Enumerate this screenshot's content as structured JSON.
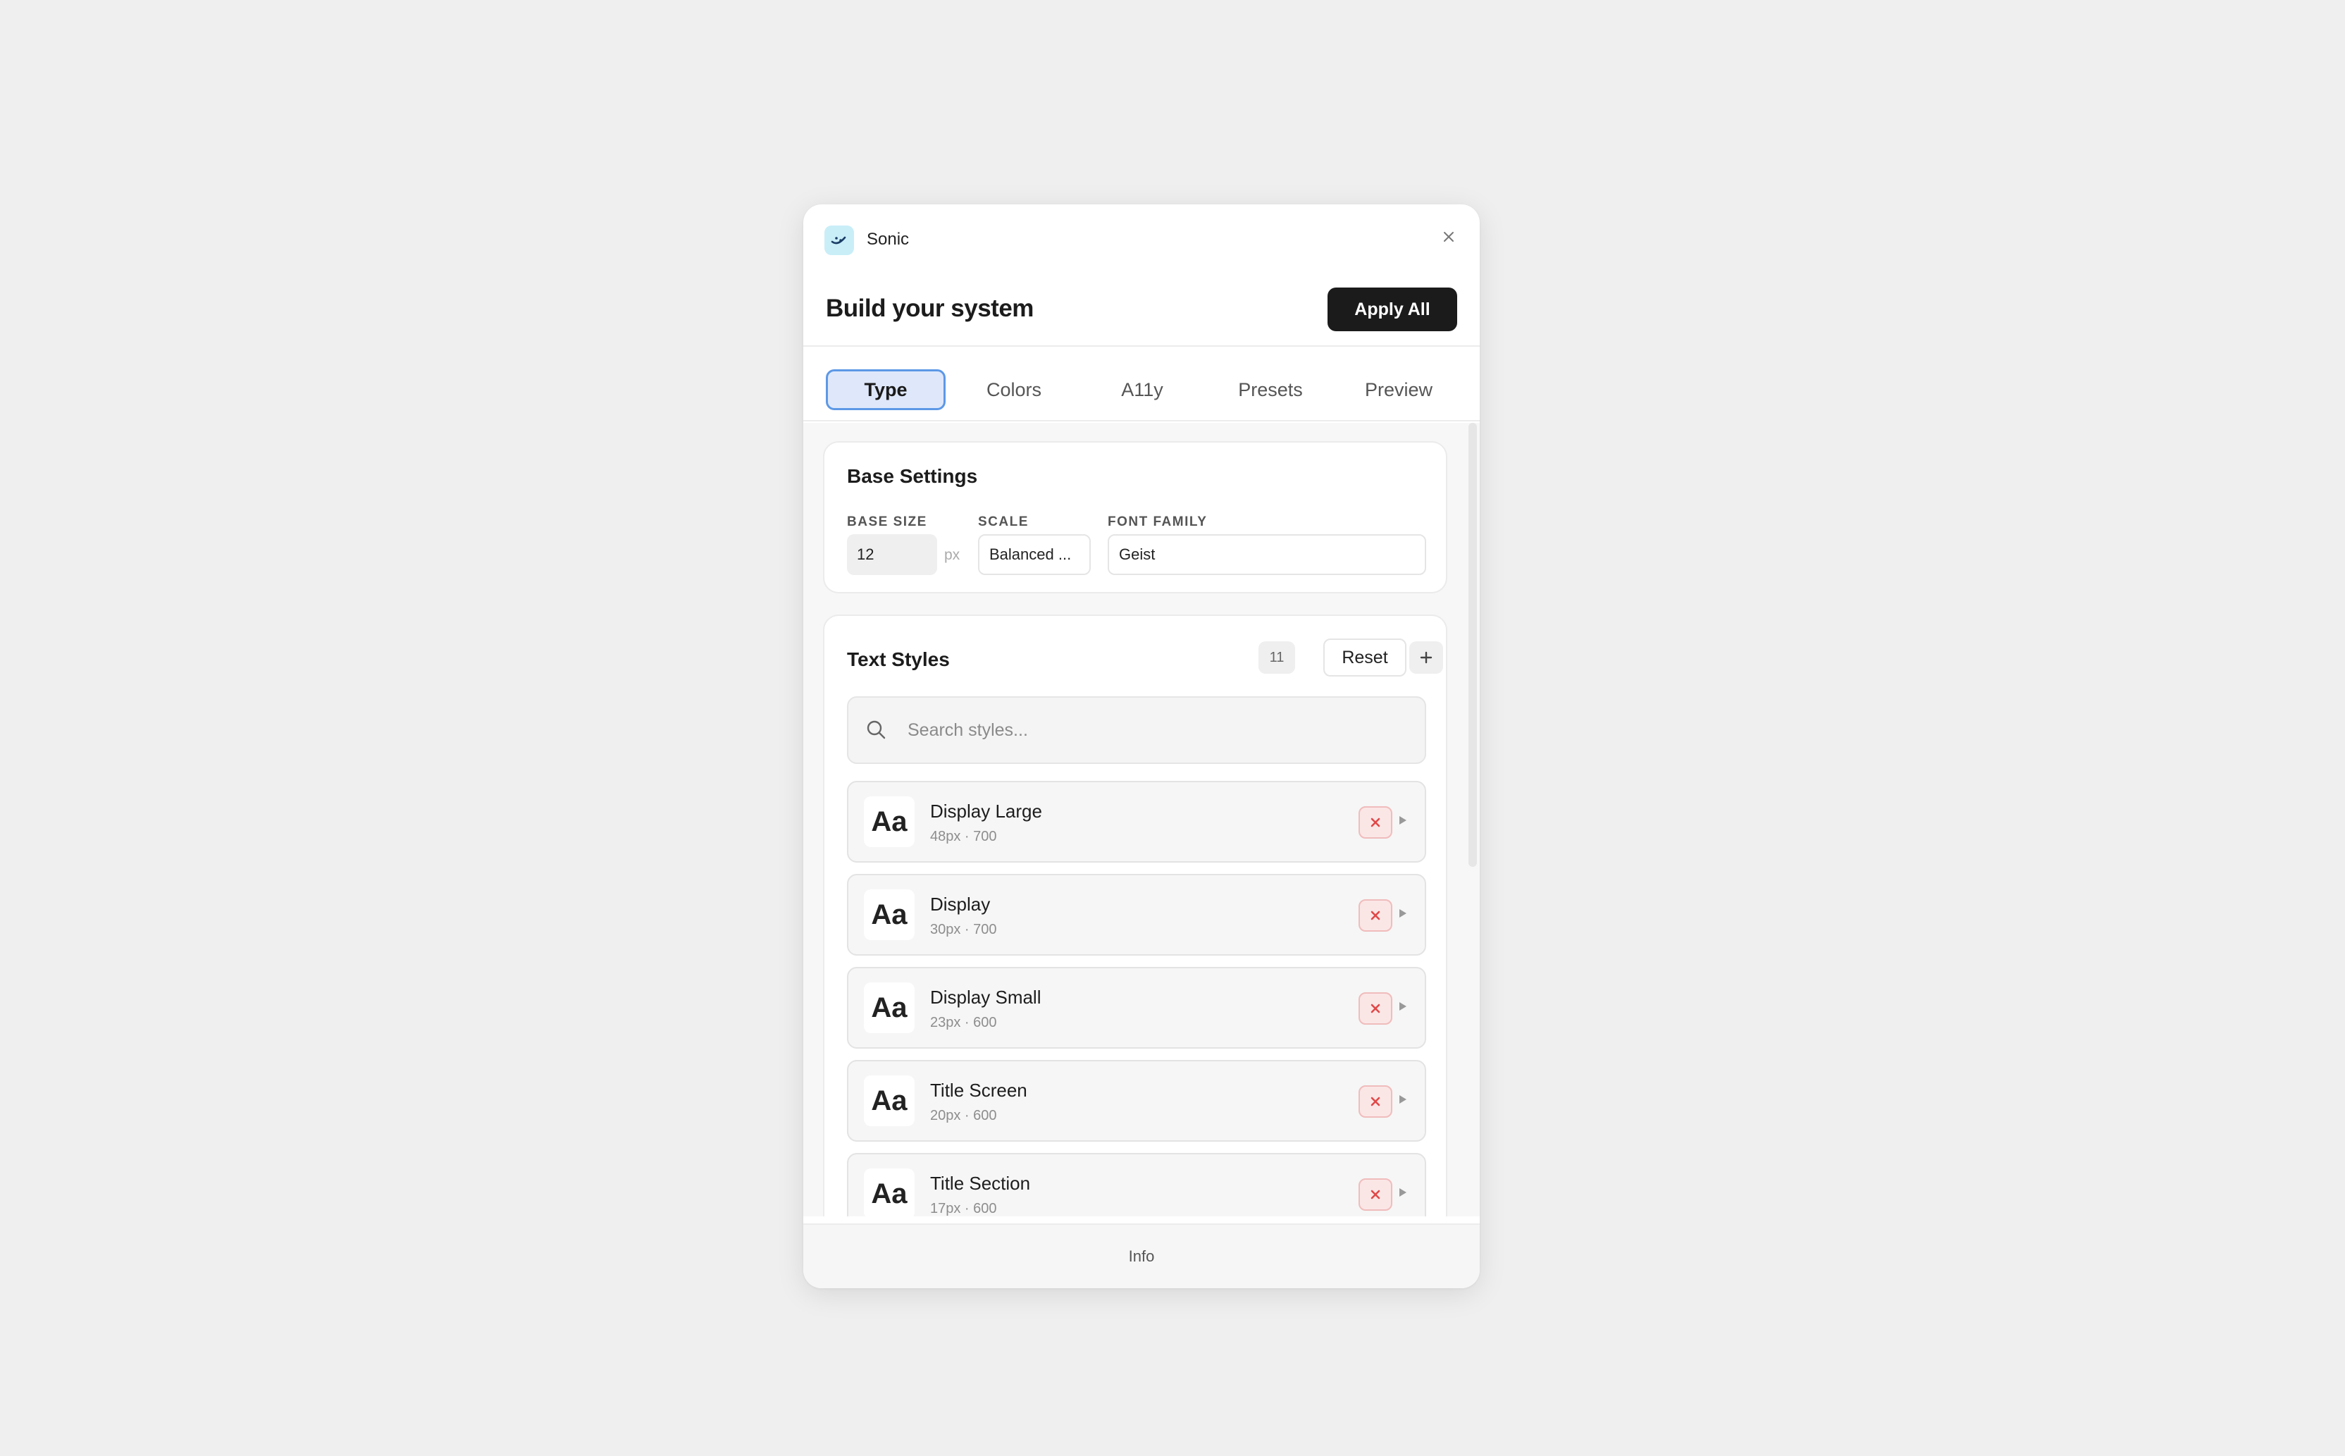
{
  "app": {
    "name": "Sonic",
    "icon": "sonic-logo-icon"
  },
  "header": {
    "title": "Build your system",
    "apply_label": "Apply All"
  },
  "tabs": [
    {
      "label": "Type",
      "active": true
    },
    {
      "label": "Colors",
      "active": false
    },
    {
      "label": "A11y",
      "active": false
    },
    {
      "label": "Presets",
      "active": false
    },
    {
      "label": "Preview",
      "active": false
    }
  ],
  "base_settings": {
    "title": "Base Settings",
    "base_size_label": "BASE SIZE",
    "base_size_value": "12",
    "base_size_unit": "px",
    "scale_label": "SCALE",
    "scale_value": "Balanced ...",
    "font_family_label": "FONT FAMILY",
    "font_family_value": "Geist"
  },
  "text_styles": {
    "title": "Text Styles",
    "count": "11",
    "reset_label": "Reset",
    "search_placeholder": "Search styles...",
    "preview_glyph": "Aa",
    "items": [
      {
        "name": "Display Large",
        "meta": "48px · 700"
      },
      {
        "name": "Display",
        "meta": "30px · 700"
      },
      {
        "name": "Display Small",
        "meta": "23px · 600"
      },
      {
        "name": "Title Screen",
        "meta": "20px · 600"
      },
      {
        "name": "Title Section",
        "meta": "17px · 600"
      }
    ]
  },
  "footer": {
    "label": "Info"
  },
  "colors": {
    "accent": "#5d98e6",
    "tab_active_bg": "#dfe8fb",
    "primary_button": "#1b1b1b",
    "danger": "#e04848"
  }
}
